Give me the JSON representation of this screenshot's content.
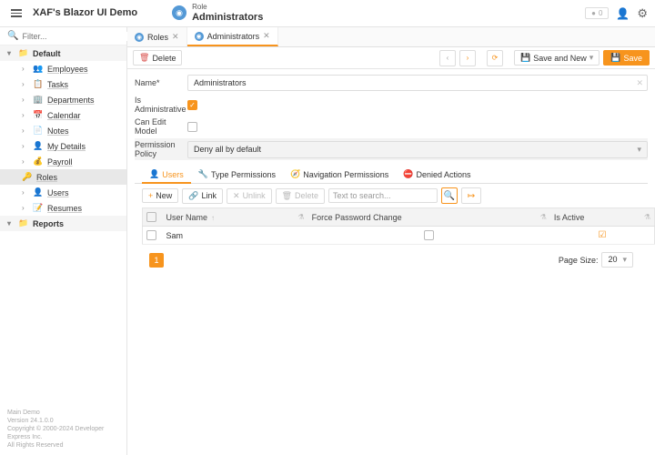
{
  "header": {
    "app_title": "XAF's Blazor UI Demo",
    "object_type": "Role",
    "object_name": "Administrators",
    "notif_count": "0"
  },
  "search": {
    "placeholder": "Filter..."
  },
  "sidebar": {
    "groups": [
      {
        "label": "Default",
        "items": [
          {
            "label": "Employees",
            "icon": "👥",
            "cls": "gray"
          },
          {
            "label": "Tasks",
            "icon": "📋",
            "cls": "red"
          },
          {
            "label": "Departments",
            "icon": "🏢",
            "cls": "blue"
          },
          {
            "label": "Calendar",
            "icon": "📅",
            "cls": "red"
          },
          {
            "label": "Notes",
            "icon": "📄",
            "cls": "blue"
          },
          {
            "label": "My Details",
            "icon": "👤",
            "cls": "gray"
          },
          {
            "label": "Payroll",
            "icon": "💰",
            "cls": "green"
          },
          {
            "label": "Roles",
            "icon": "🔑",
            "cls": "gray",
            "selected": true
          },
          {
            "label": "Users",
            "icon": "👤",
            "cls": "gray"
          },
          {
            "label": "Resumes",
            "icon": "📝",
            "cls": "gray"
          }
        ]
      },
      {
        "label": "Reports"
      }
    ]
  },
  "tabs": [
    {
      "label": "Roles",
      "active": false
    },
    {
      "label": "Administrators",
      "active": true
    }
  ],
  "toolbar": {
    "delete": "Delete",
    "save_new": "Save and New",
    "save": "Save"
  },
  "form": {
    "name_label": "Name*",
    "name_value": "Administrators",
    "is_admin_label": "Is Administrative",
    "is_admin_value": true,
    "can_edit_label": "Can Edit Model",
    "can_edit_value": false,
    "policy_label": "Permission Policy",
    "policy_value": "Deny all by default"
  },
  "subtabs": [
    {
      "label": "Users",
      "icon": "👤",
      "active": true,
      "cls": "red"
    },
    {
      "label": "Type Permissions",
      "icon": "🔧",
      "cls": "green"
    },
    {
      "label": "Navigation Permissions",
      "icon": "🧭",
      "cls": "blue"
    },
    {
      "label": "Denied Actions",
      "icon": "⛔",
      "cls": "green"
    }
  ],
  "gridbar": {
    "new": "New",
    "link": "Link",
    "unlink": "Unlink",
    "delete": "Delete",
    "search_placeholder": "Text to search..."
  },
  "grid": {
    "cols": [
      "User Name",
      "Force Password Change",
      "Is Active"
    ],
    "rows": [
      {
        "user": "Sam",
        "force": false,
        "active": true
      }
    ]
  },
  "pager": {
    "page": "1",
    "size_label": "Page Size:",
    "size": "20"
  },
  "footer": {
    "l1": "Main Demo",
    "l2": "Version 24.1.0.0",
    "l3": "Copyright © 2000-2024 Developer Express Inc.",
    "l4": "All Rights Reserved"
  }
}
